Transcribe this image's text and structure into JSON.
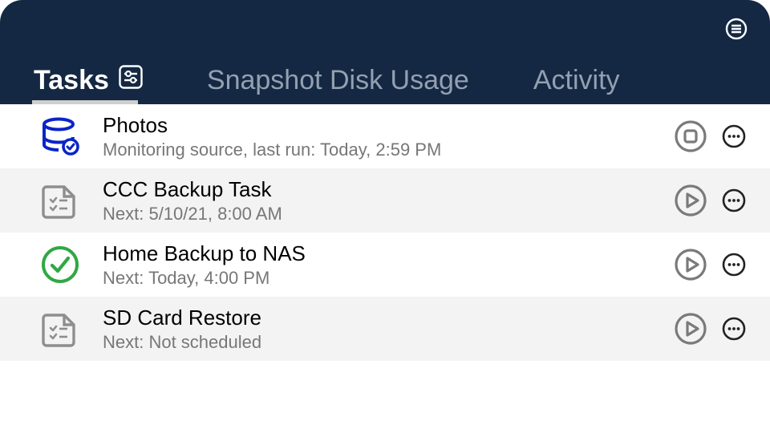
{
  "tabs": [
    {
      "label": "Tasks",
      "active": true
    },
    {
      "label": "Snapshot Disk Usage",
      "active": false
    },
    {
      "label": "Activity",
      "active": false
    }
  ],
  "tasks": [
    {
      "icon": "database-active",
      "title": "Photos",
      "subtitle": "Monitoring source, last run: Today, 2:59 PM",
      "action": "stop"
    },
    {
      "icon": "checklist",
      "title": "CCC Backup Task",
      "subtitle": "Next: 5/10/21, 8:00 AM",
      "action": "play"
    },
    {
      "icon": "checkmark",
      "title": "Home Backup to NAS",
      "subtitle": "Next: Today, 4:00 PM",
      "action": "play"
    },
    {
      "icon": "checklist",
      "title": "SD Card Restore",
      "subtitle": "Next: Not scheduled",
      "action": "play"
    }
  ]
}
